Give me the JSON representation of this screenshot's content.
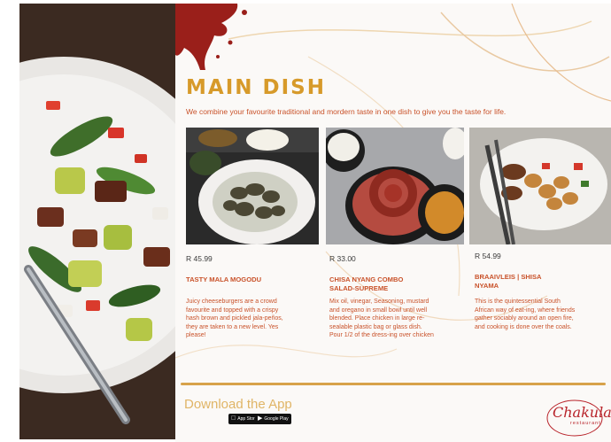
{
  "header": {
    "title": "MAIN DISH",
    "subtitle": "We combine your favourite traditional and mordern taste in one dish to give you the taste for life."
  },
  "dishes": [
    {
      "price": "R 45.99",
      "name": "TASTY MALA MOGODU",
      "description": "Juicy cheeseburgers are a crowd favourite and topped with a crispy hash brown and pickled jala-peños, they are taken to a new level. Yes please!"
    },
    {
      "price": "R 33.00",
      "name": "CHISA NYANG COMBO SALAD-SUPREME",
      "description": "Mix oil, vinegar, Seasoning, mustard and oregano in small bowl until well blended. Place chicken in large re-sealable plastic bag or glass dish. Pour 1/2 of the dress-ing over chicken"
    },
    {
      "price": "R 54.99",
      "name": "BRAAIVLEIS | SHISA NYAMA",
      "description": "This is the quintessential South African way of eat-ing, where friends gather sociably around an open fire, and cooking is done over the coals."
    }
  ],
  "footer": {
    "download_label": "Download the App",
    "app_store_label": "App Store",
    "google_play_label": "Google Play"
  },
  "logo": {
    "name": "Chakula",
    "subtitle": "restaurant"
  },
  "colors": {
    "title": "#d79a2a",
    "accent": "#c9522a",
    "logo": "#b8232a",
    "gold_line": "#d7a24a"
  }
}
